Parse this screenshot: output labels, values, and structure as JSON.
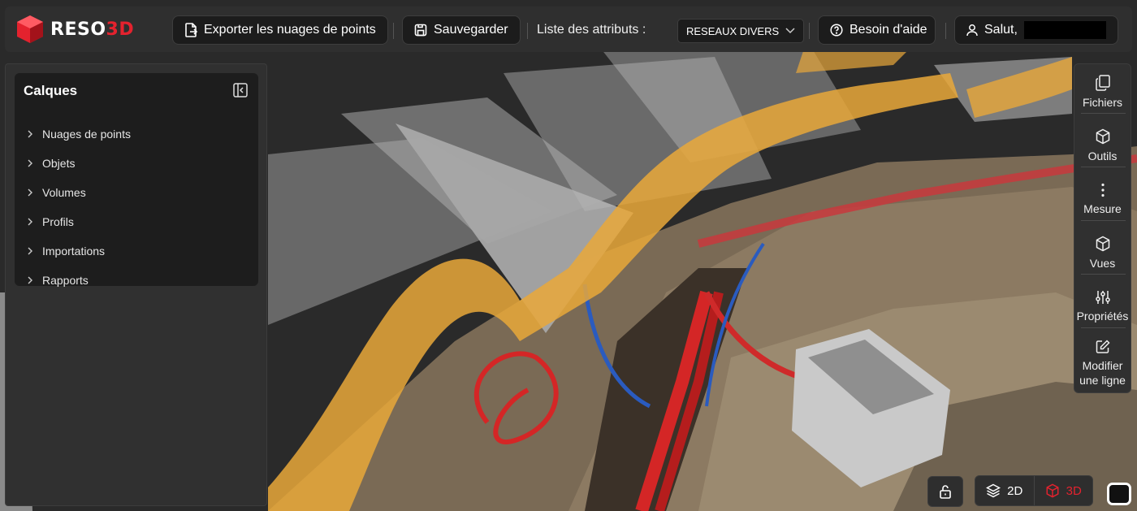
{
  "header": {
    "logo_text_1": "RESO",
    "logo_text_2": "3D",
    "export_label": "Exporter les nuages de points",
    "save_label": "Sauvegarder",
    "attributes_label": "Liste des attributs :",
    "attributes_selected": "RESEAUX DIVERS",
    "help_label": "Besoin d'aide",
    "greeting": "Salut,"
  },
  "sidebar": {
    "title": "Calques",
    "items": [
      {
        "label": "Nuages de points"
      },
      {
        "label": "Objets"
      },
      {
        "label": "Volumes"
      },
      {
        "label": "Profils"
      },
      {
        "label": "Importations"
      },
      {
        "label": "Rapports"
      }
    ]
  },
  "right_toolbar": {
    "items": [
      {
        "label": "Fichiers",
        "icon": "files-icon"
      },
      {
        "label": "Outils",
        "icon": "cube-icon"
      },
      {
        "label": "Mesure",
        "icon": "dots-vertical-icon"
      },
      {
        "label": "Vues",
        "icon": "cube-icon"
      },
      {
        "label": "Propriétés",
        "icon": "sliders-icon"
      },
      {
        "label": "Modifier une ligne",
        "icon": "edit-icon"
      }
    ]
  },
  "view_modes": {
    "mode_2d": "2D",
    "mode_3d": "3D",
    "active": "3D"
  },
  "colors": {
    "brand_red": "#e4222e",
    "background": "#2b2b2b",
    "panel": "#303030"
  }
}
